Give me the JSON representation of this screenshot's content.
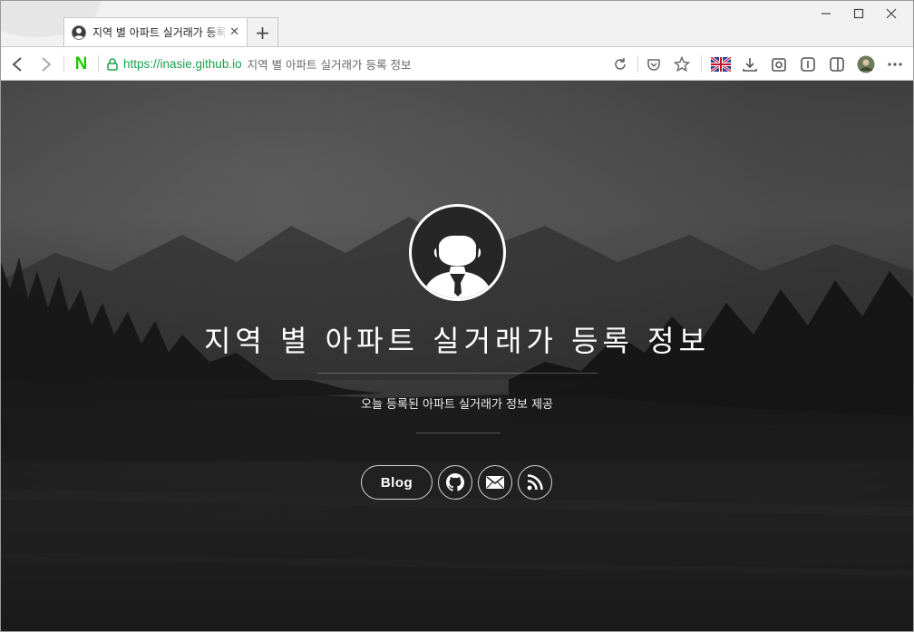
{
  "browser": {
    "tab": {
      "title": "지역 별 아파트 실거래가 등록 정보",
      "close_icon": "close-icon"
    },
    "new_tab_label": "+",
    "window_controls": {
      "minimize": "—",
      "maximize": "☐",
      "close": "✕"
    },
    "address": {
      "url": "https://inasie.github.io",
      "page_title": "지역 별 아파트 실거래가 등록 정보"
    },
    "toolbar_icons": [
      "back-icon",
      "forward-icon",
      "naver-icon",
      "reload-icon",
      "pocket-icon",
      "star-icon",
      "language-flag-icon",
      "download-icon",
      "capture-icon",
      "reader-icon",
      "sidebar-icon",
      "profile-icon",
      "more-icon"
    ],
    "naver_label": "N"
  },
  "page": {
    "title": "지역 별 아파트 실거래가 등록 정보",
    "subtitle": "오늘 등록된 아파트 실거래가 정보 제공",
    "links": {
      "blog_label": "Blog"
    }
  },
  "colors": {
    "accent_green": "#1ec800",
    "url_green": "#16a34a",
    "hero_text": "#ffffff"
  }
}
